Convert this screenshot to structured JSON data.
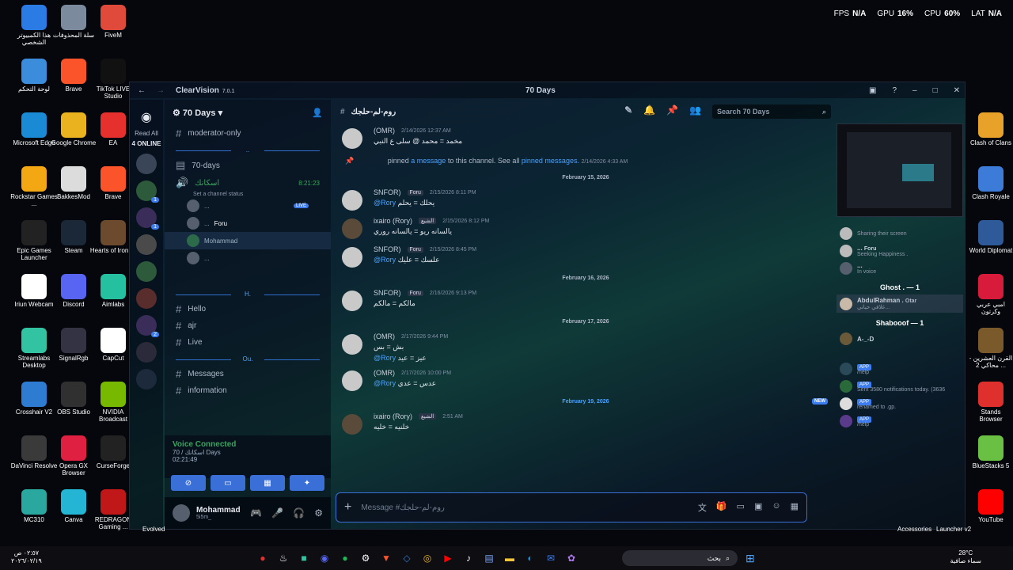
{
  "perf": {
    "fps_label": "FPS",
    "fps": "N/A",
    "gpu_label": "GPU",
    "gpu": "16%",
    "cpu_label": "CPU",
    "cpu": "60%",
    "lat_label": "LAT",
    "lat": "N/A"
  },
  "desktop_left": [
    {
      "label": "هذا الكمبيوتر الشخصي",
      "color": "#2a7be4"
    },
    {
      "label": "سلة المحذوفات",
      "color": "#7b8a9c"
    },
    {
      "label": "FiveM",
      "color": "#e04a3a"
    },
    {
      "label": "لوحة التحكم",
      "color": "#3b8ddc"
    },
    {
      "label": "Brave",
      "color": "#fb542b"
    },
    {
      "label": "TikTok LIVE Studio",
      "color": "#111111"
    },
    {
      "label": "Microsoft Edge",
      "color": "#1a8ad4"
    },
    {
      "label": "Google Chrome",
      "color": "#e9b21e"
    },
    {
      "label": "EA",
      "color": "#e5302d"
    },
    {
      "label": "Rockstar Games ...",
      "color": "#f3a712"
    },
    {
      "label": "BakkesMod",
      "color": "#dcdcdc"
    },
    {
      "label": "Brave",
      "color": "#fb542b"
    },
    {
      "label": "Epic Games Launcher",
      "color": "#222222"
    },
    {
      "label": "Steam",
      "color": "#1b2838"
    },
    {
      "label": "Hearts of Iron IV",
      "color": "#6b4a2e"
    },
    {
      "label": "Iriun Webcam",
      "color": "#ffffff"
    },
    {
      "label": "Discord",
      "color": "#5865f2"
    },
    {
      "label": "Aimlabs",
      "color": "#24c0a0"
    },
    {
      "label": "Streamlabs Desktop",
      "color": "#31c3a2"
    },
    {
      "label": "SignalRgb",
      "color": "#333344"
    },
    {
      "label": "CapCut",
      "color": "#ffffff"
    },
    {
      "label": "Crosshair V2",
      "color": "#2e7bd2"
    },
    {
      "label": "OBS Studio",
      "color": "#303030"
    },
    {
      "label": "NVIDIA Broadcast",
      "color": "#76b900"
    },
    {
      "label": "DaVinci Resolve",
      "color": "#3a3a3a"
    },
    {
      "label": "Opera GX Browser",
      "color": "#e02040"
    },
    {
      "label": "CurseForge",
      "color": "#222222"
    },
    {
      "label": "MC310",
      "color": "#2aa8a0"
    },
    {
      "label": "Canva",
      "color": "#23b5d3"
    },
    {
      "label": "REDRAGON Gaming ...",
      "color": "#c01818"
    }
  ],
  "desktop_right": [
    {
      "label": "Clash of Clans",
      "color": "#e8a22a"
    },
    {
      "label": "Clash Royale",
      "color": "#3d7bd8"
    },
    {
      "label": "World Diplomat",
      "color": "#2e5a9a"
    },
    {
      "label": "امبي عربي وكرتون",
      "color": "#d81b3a"
    },
    {
      "label": "القرن العشرين - محاكي 2 ...",
      "color": "#7a5a2a"
    },
    {
      "label": "Stands Browser",
      "color": "#e0302d"
    },
    {
      "label": "BlueStacks 5",
      "color": "#6ac043"
    },
    {
      "label": "YouTube",
      "color": "#ff0000"
    }
  ],
  "window": {
    "brand": "ClearVision",
    "version": "7.0.1",
    "title": "70 Days"
  },
  "rail": {
    "read_all": "Read All",
    "online": "4 ONLINE"
  },
  "server": {
    "name": "70 Days"
  },
  "channels": {
    "top": [
      {
        "name": "moderator-only"
      }
    ],
    "cat1": "..",
    "cat1_items": [
      {
        "name": "70-days"
      }
    ],
    "voice_channel": {
      "name": "اسكانك",
      "timer": "8:21:23",
      "status": "Set a channel status"
    },
    "voice_users": [
      {
        "name": "...",
        "live": "LIVE"
      },
      {
        "name": "...",
        "tag": "Foru"
      },
      {
        "name": "Mohammad"
      },
      {
        "name": "..."
      }
    ],
    "cat2": "H.",
    "cat2_items": [
      {
        "name": "Hello"
      },
      {
        "name": "ajr"
      },
      {
        "name": "Live"
      }
    ],
    "cat3": "Ou.",
    "cat3_items": [
      {
        "name": "Messages"
      },
      {
        "name": "information"
      }
    ]
  },
  "voice_panel": {
    "title": "Voice Connected",
    "sub": "70 / اسكانك Days",
    "timer": "02:21:49"
  },
  "user": {
    "name": "Mohammad",
    "tag": "5i5m_"
  },
  "chat": {
    "channel": "روم-لم-حلجك",
    "search_placeholder": "Search 70 Days",
    "composer_placeholder": "Message #روم-لم-حلجك",
    "system": {
      "pre": "pinned",
      "link1": "a message",
      "mid": "to this channel. See all",
      "link2": "pinned messages.",
      "time": "2/14/2026 4:33 AM"
    },
    "msg0": {
      "name": "(OMR)",
      "time": "2/14/2026 12:37 AM",
      "body": "مخمد = محمد @ سلى ع النبي"
    },
    "date1": "February 15, 2026",
    "msg1": {
      "name": "SNFOR)",
      "tag": "Foru",
      "time": "2/15/2026 8:11 PM",
      "reply": "@Rory",
      "body": "يحلك = يحلم"
    },
    "msg2": {
      "name": "ixairo (Rory)",
      "tag": "الشيع",
      "time": "2/15/2026 8:12 PM",
      "body": "يالسانه ريو = يالسانه روري"
    },
    "msg3": {
      "name": "SNFOR)",
      "tag": "Foru",
      "time": "2/15/2026 8:45 PM",
      "reply": "@Rory",
      "body": "علسك = عليك"
    },
    "date2": "February 16, 2026",
    "msg4": {
      "name": "SNFOR)",
      "tag": "Foru",
      "time": "2/16/2026 9:13 PM",
      "body": "مالكم = مالكم"
    },
    "date3": "February 17, 2026",
    "msg5": {
      "name": "(OMR)",
      "time": "2/17/2026 9:44 PM",
      "body": "بش = بس",
      "reply": "@Rory",
      "body2": "عيز = عيد"
    },
    "msg6": {
      "name": "(OMR)",
      "time": "2/17/2026 10:00 PM",
      "reply": "@Rory",
      "body": "عدس = عدي"
    },
    "date4": "February 19, 2026",
    "msg7": {
      "name": "ixairo (Rory)",
      "tag": "الشيع",
      "time": "2:51 AM",
      "body": "خلنيه = خليه"
    }
  },
  "members": {
    "count": "4",
    "streaming": "Sharing their screen",
    "list1": [
      {
        "name": "...",
        "tag": "Foru",
        "status": "Seeking Happiness ."
      },
      {
        "name": "...",
        "status": "In voice"
      }
    ],
    "group1": "Ghost . — 1",
    "ghost": {
      "name": "AbdulRahman .",
      "tag": "Otar",
      "status": "غلافي حياتي..."
    },
    "group2": "Shabooof — 1",
    "shabooof": {
      "name": "A-_-D"
    },
    "bots": [
      {
        "name": "/help",
        "badge": "APP"
      },
      {
        "name": "Sent 3580 notifications today. (3636",
        "badge": "APP"
      },
      {
        "name": "renamed to .gp.",
        "badge": "APP"
      },
      {
        "name": "/help",
        "badge": "APP"
      }
    ]
  },
  "taskbar": {
    "time": "٠٢:٥٧ ص",
    "date": "٢٠٢٦/٠٢/١٩",
    "search": "بحث",
    "temp": "28°C",
    "weather": "سماء صافية",
    "bottom_labels": [
      "Evolved",
      "Accessories",
      "Launcher v2"
    ]
  }
}
